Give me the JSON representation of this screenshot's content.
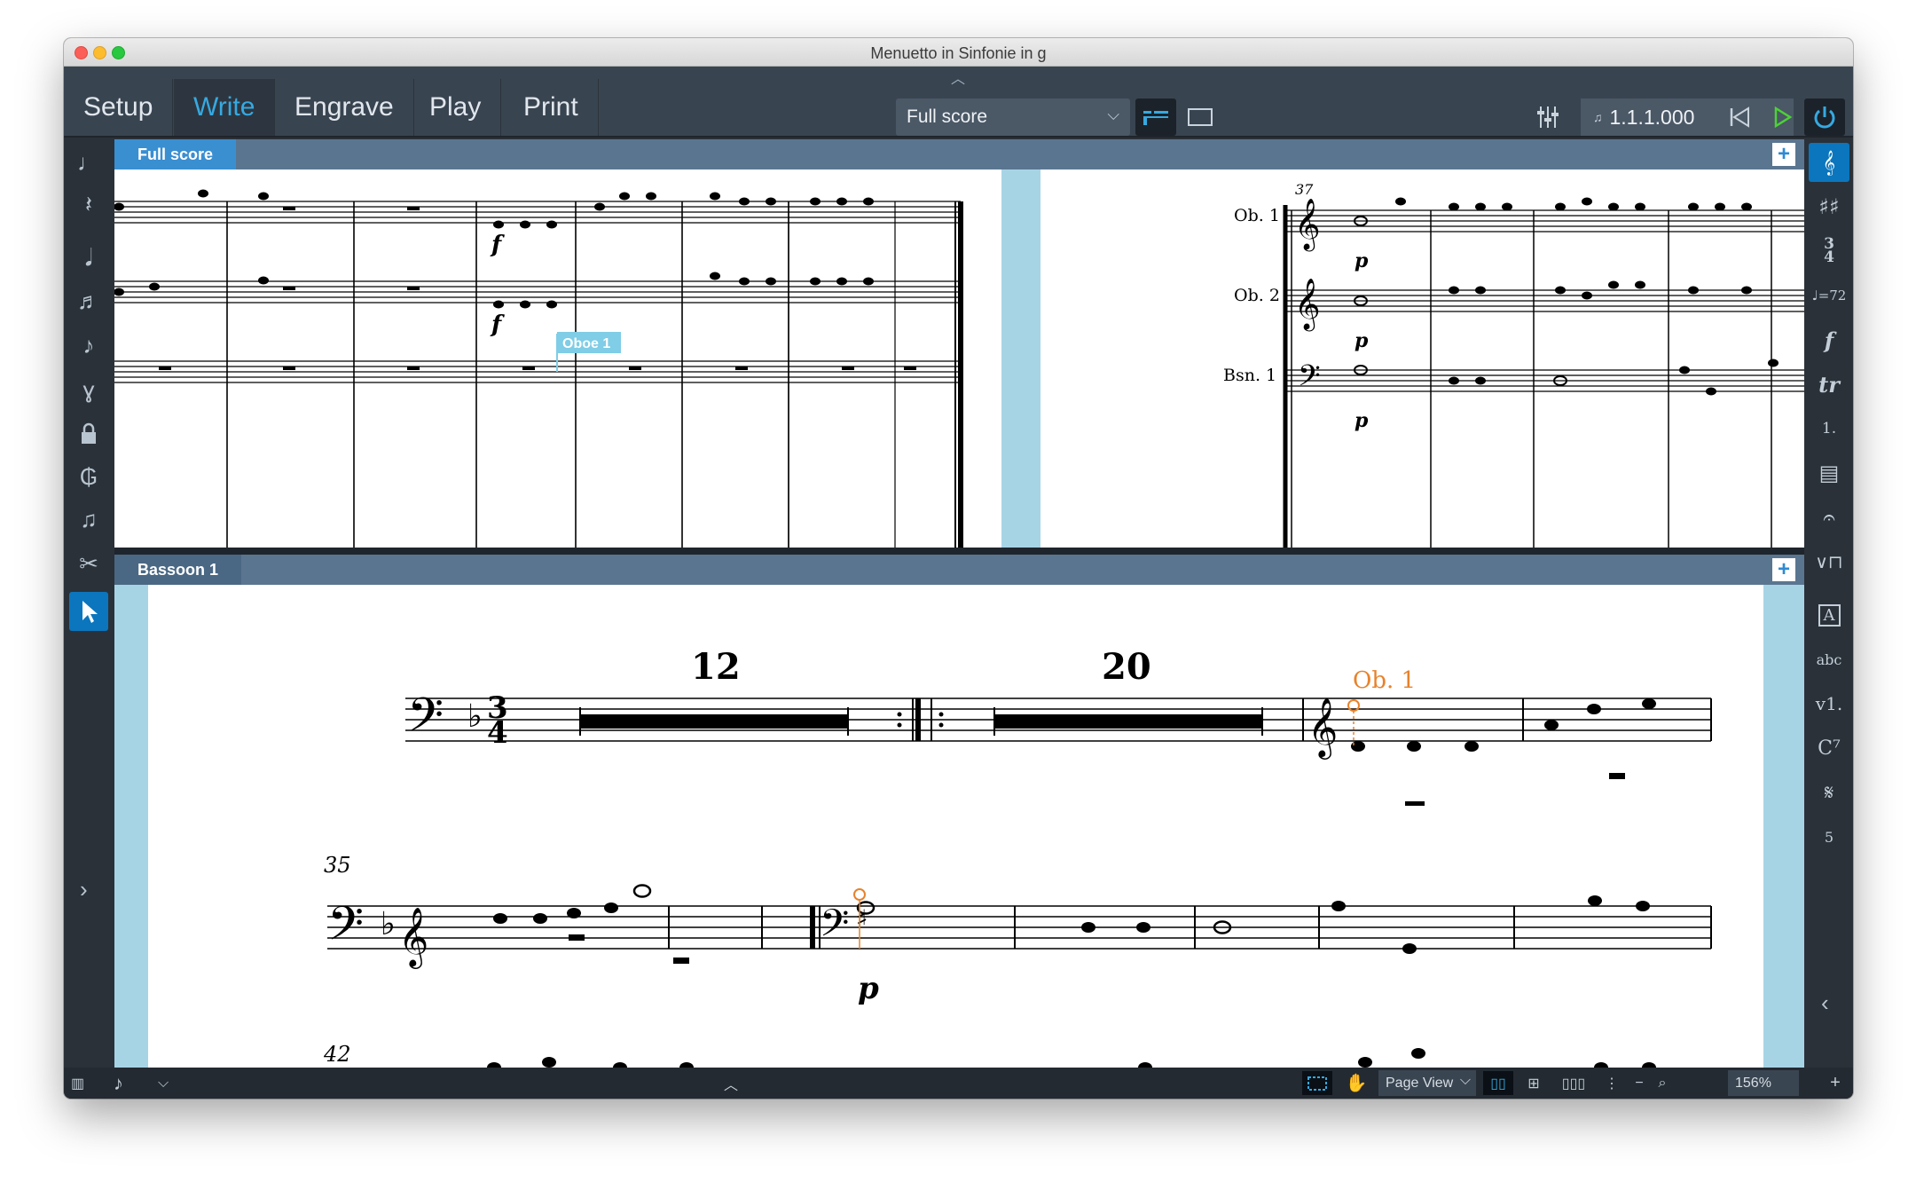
{
  "window": {
    "title": "Menuetto in Sinfonie in g"
  },
  "toolbar": {
    "modes": [
      {
        "label": "Setup",
        "active": false
      },
      {
        "label": "Write",
        "active": true
      },
      {
        "label": "Engrave",
        "active": false
      },
      {
        "label": "Play",
        "active": false
      },
      {
        "label": "Print",
        "active": false
      }
    ],
    "layout_select": "Full score",
    "position_counter": "1.1.1.000"
  },
  "left_tools": [
    "note-icon",
    "rest-icon",
    "tremolo-icon",
    "tuplet-icon",
    "grace-note-icon",
    "unpitched-icon",
    "lock-duration-icon",
    "force-position-icon",
    "chord-icon",
    "scissors-icon",
    "select-arrow-icon"
  ],
  "right_tools": [
    "clef-icon",
    "key-signature-icon",
    "time-signature-icon",
    "tempo-icon",
    "dynamics-icon",
    "ornaments-icon",
    "repeat-endings-icon",
    "bars-icon",
    "holds-pauses-icon",
    "playing-techniques-icon",
    "text-icon",
    "lyrics-icon",
    "rehearsal-icon",
    "chord-symbols-icon",
    "ear-icon",
    "fingering-icon"
  ],
  "right_glyphs": {
    "text_box": "A",
    "lyrics": "abc",
    "rehearsal": "v1.",
    "chords": "C⁷",
    "tempo": "♩=72",
    "fingering": "5"
  },
  "top_pane": {
    "tab_label": "Full score",
    "bar_number": "37",
    "staff_labels": [
      "Ob. 1",
      "Ob. 2",
      "Bsn. 1"
    ],
    "dynamic_marks": [
      "f",
      "f",
      "p",
      "p",
      "p"
    ],
    "caret_label": "Oboe 1"
  },
  "bottom_pane": {
    "tab_label": "Bassoon 1",
    "multirest_counts": [
      "12",
      "20"
    ],
    "cue_label": "Ob. 1",
    "bar_numbers": [
      "35",
      "42"
    ],
    "dynamic": "p"
  },
  "statusbar": {
    "view_select": "Page View",
    "zoom": "156%"
  },
  "colors": {
    "accent": "#36a9e1",
    "selected_tool": "#0b76bd",
    "cue_orange": "#e8822b",
    "caret_blue": "#7fcde6"
  }
}
